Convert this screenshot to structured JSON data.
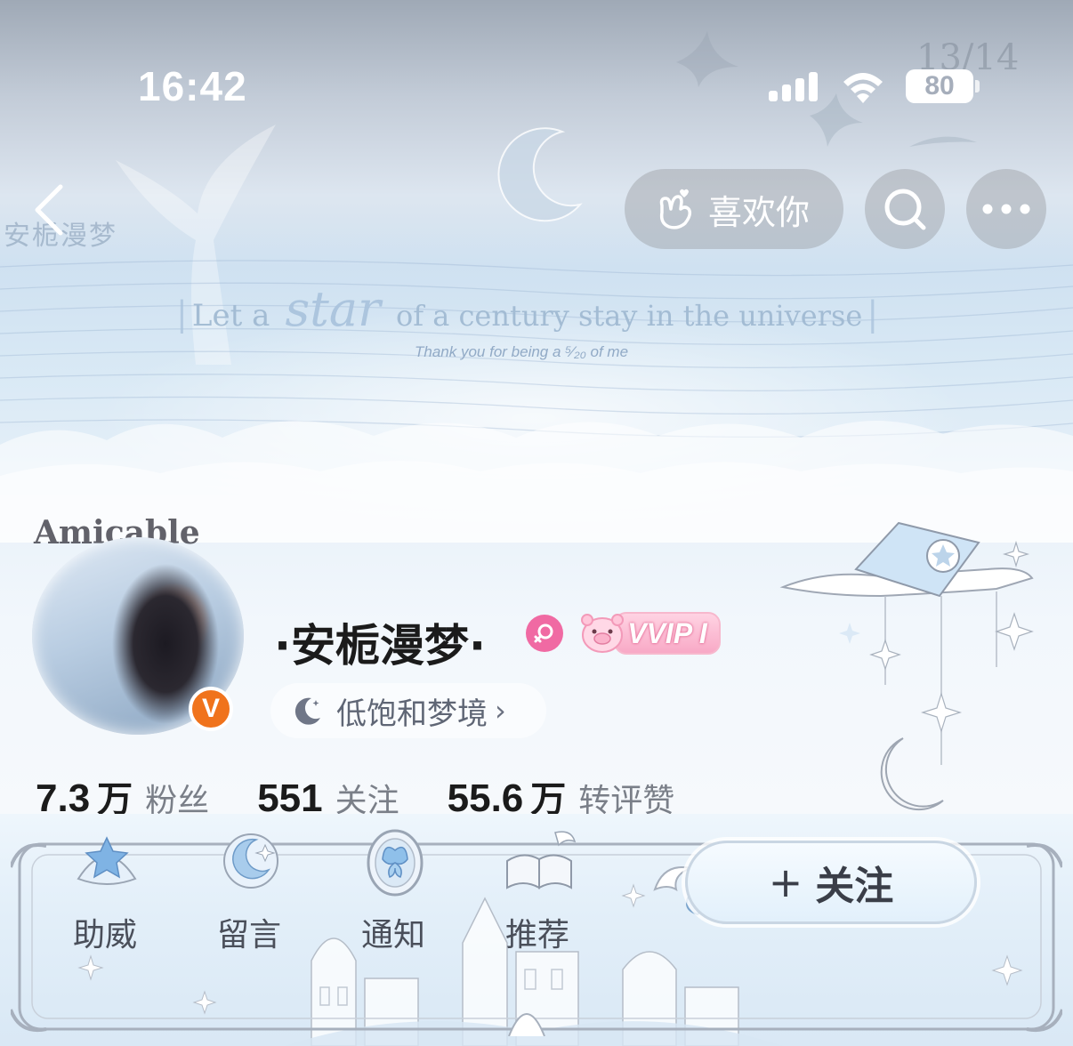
{
  "status_bar": {
    "time": "16:42",
    "battery": "80",
    "signal_icon": "cellular-signal-icon",
    "wifi_icon": "wifi-icon"
  },
  "banner": {
    "watermark": "安栀漫梦",
    "date_mark": "13/14",
    "quote_part1": "Let a",
    "quote_star": "star",
    "quote_part2": "of a century stay in the universe",
    "subline": "Thank you for being a ⁵⁄₂₀ of me",
    "avatar_frame_title": "Amicable"
  },
  "nav": {
    "back_icon": "chevron-left-icon",
    "like_label": "喜欢你",
    "like_icon": "hand-heart-icon",
    "search_icon": "search-icon",
    "more_icon": "more-dots-icon"
  },
  "profile": {
    "name": "·安栀漫梦·",
    "verified_mark": "V",
    "vip_label": "VVIP I",
    "signature": "低饱和梦境",
    "signature_chevron": "›"
  },
  "stats": [
    {
      "value": "7.3",
      "unit": "万",
      "label": "粉丝"
    },
    {
      "value": "551",
      "unit": "",
      "label": "关注"
    },
    {
      "value": "55.6",
      "unit": "万",
      "label": "转评赞"
    }
  ],
  "actions": {
    "boost": "助威",
    "message": "留言",
    "notify": "通知",
    "recommend": "推荐",
    "follow_plus": "+",
    "follow": "关注"
  },
  "colors": {
    "verified_orange": "#f0731c",
    "gender_pink": "#f06aa3",
    "vip_pink": "#f8a9c6",
    "banner_blue": "#cfe1f1"
  }
}
